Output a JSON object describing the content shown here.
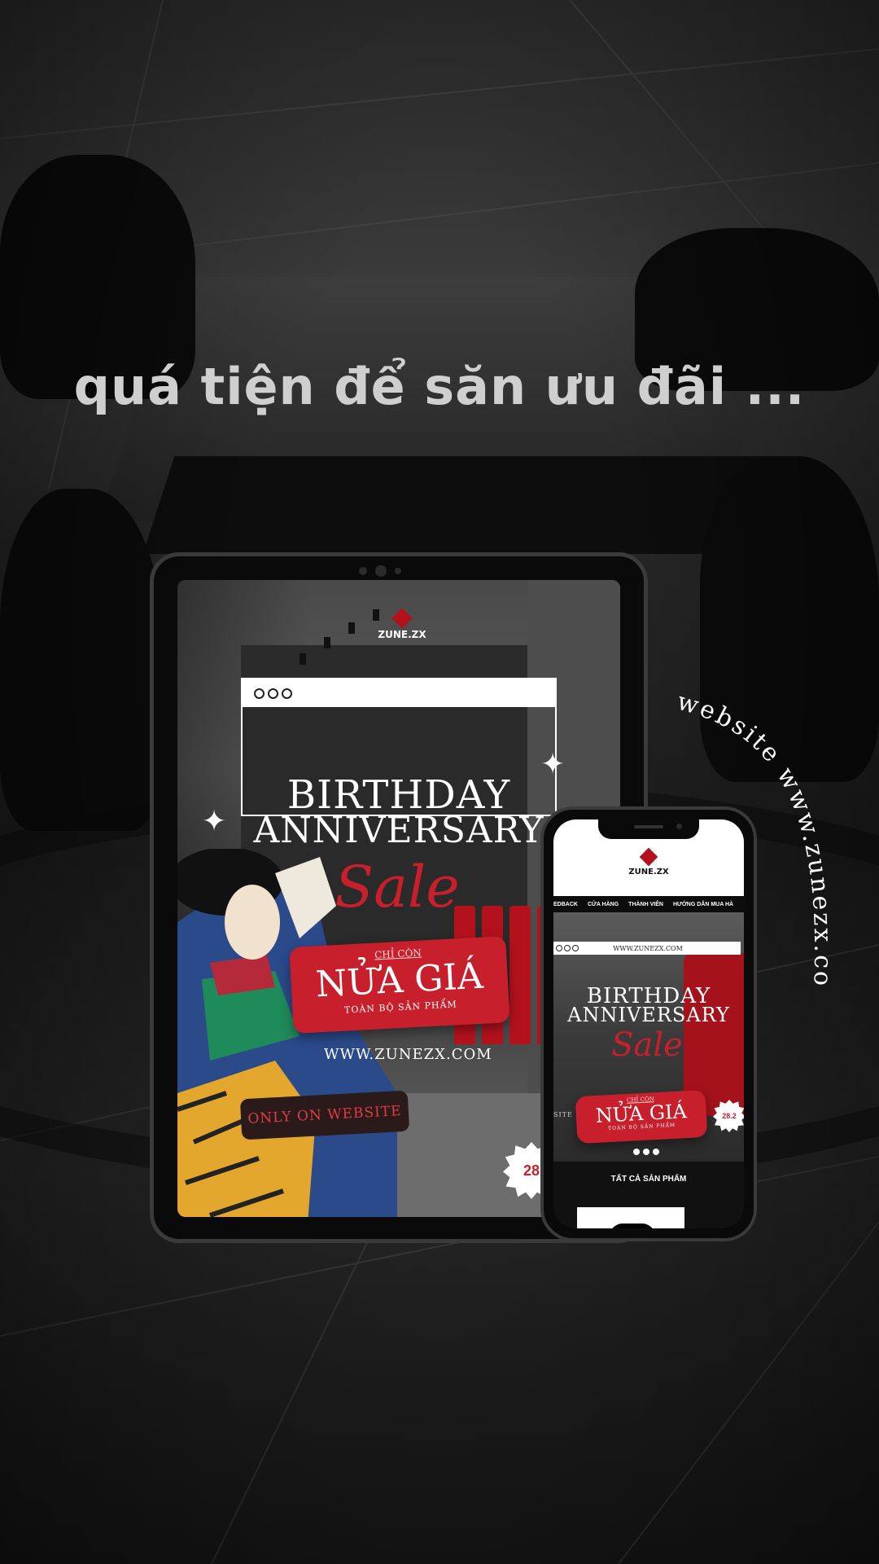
{
  "headline": "quá tiện để săn ưu đãi ...",
  "side_caption": "website www.zunezx.com",
  "tablet": {
    "logo_text": "ZUNE.ZX",
    "title_line1": "BIRTHDAY",
    "title_line2": "ANNIVERSARY",
    "sale_word": "Sale",
    "badge_top": "CHỈ CÒN",
    "badge_main": "NỬA GIÁ",
    "badge_sub": "TOÀN BỘ SẢN PHẨM",
    "url": "WWW.ZUNEZX.COM",
    "only_label": "ONLY ON WEBSITE",
    "date_badge": "28"
  },
  "phone": {
    "logo_text": "ZUNE.ZX",
    "nav": [
      "EDBACK",
      "CỬA HÀNG",
      "THÀNH VIÊN",
      "HƯỚNG DẪN MUA HÀ"
    ],
    "browser_url": "WWW.ZUNEZX.COM",
    "title_line1": "BIRTHDAY",
    "title_line2": "ANNIVERSARY",
    "sale_word": "Sale",
    "badge_top": "CHỈ CÒN",
    "badge_main": "NỬA GIÁ",
    "badge_sub": "TOÀN BỘ SẢN PHẨM",
    "date_badge": "28.2",
    "side_clip": "SITE",
    "all_products": "TẤT CẢ SẢN PHẨM"
  },
  "colors": {
    "accent_red": "#c7202c",
    "headline_gray": "#cfcfcf"
  }
}
